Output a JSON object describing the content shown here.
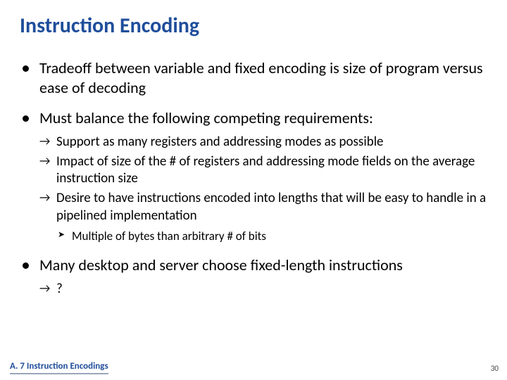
{
  "title": "Instruction Encoding",
  "bullets": [
    {
      "text": "Tradeoff between variable and fixed encoding is size of program versus ease of decoding"
    },
    {
      "text": "Must balance the following competing requirements:",
      "sub": [
        {
          "text": "Support as many registers and addressing modes as possible"
        },
        {
          "text": "Impact of size of the # of registers and addressing mode fields on the average instruction size"
        },
        {
          "text": "Desire to have instructions encoded into lengths that will be easy to handle in a pipelined implementation",
          "sub": [
            {
              "text": "Multiple of bytes than arbitrary # of bits"
            }
          ]
        }
      ]
    },
    {
      "text": "Many desktop and server choose fixed-length instructions",
      "sub": [
        {
          "text": "?"
        }
      ]
    }
  ],
  "footer": "A. 7  Instruction Encodings",
  "page": "30"
}
